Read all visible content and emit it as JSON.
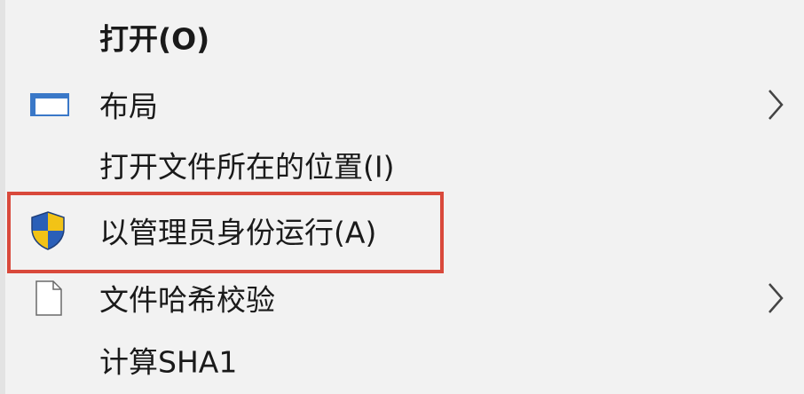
{
  "menu": {
    "items": [
      {
        "label": "打开(O)",
        "bold": true,
        "icon": null,
        "submenu": false
      },
      {
        "label": "布局",
        "bold": false,
        "icon": "layout-window-icon",
        "submenu": true
      },
      {
        "label": "打开文件所在的位置(I)",
        "bold": false,
        "icon": null,
        "submenu": false
      },
      {
        "label": "以管理员身份运行(A)",
        "bold": false,
        "icon": "uac-shield-icon",
        "submenu": false,
        "highlighted": true
      },
      {
        "label": "文件哈希校验",
        "bold": false,
        "icon": "file-icon",
        "submenu": true
      },
      {
        "label": "计算SHA1",
        "bold": false,
        "icon": null,
        "submenu": false
      }
    ],
    "highlight_color": "#d9493b"
  }
}
